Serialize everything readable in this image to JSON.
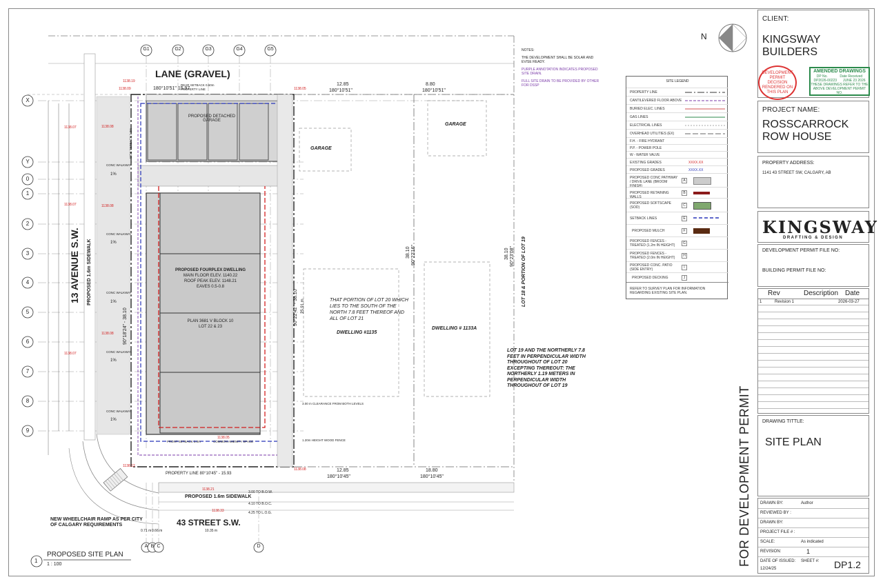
{
  "title_block": {
    "client_label": "CLIENT:",
    "client_name": "KINGSWAY BUILDERS",
    "stamp_text": "DEVELOPMENT PERMIT DECISION RENDERED ON THIS PLAN",
    "amended_title": "AMENDED DRAWINGS",
    "amended_dp_no_label": "DP No.",
    "amended_date_label": "Date Received",
    "amended_dp_no": "DP2026-00223",
    "amended_date": "JUNE 23 2026",
    "amended_note": "THESE DRAWINGS REFER TO THE ABOVE DEVELOPMENT PERMIT NO.",
    "project_name_label": "PROJECT NAME:",
    "project_name": "ROSSCARROCK ROW HOUSE",
    "property_address_label": "PROPERTY ADDRESS:",
    "property_address": "1141 43 STREET SW, CALGARY, AB",
    "logo_main": "KINGSWAY",
    "logo_sub": "DRAFTING & DESIGN",
    "dp_file_label": "DEVELOPMENT PERMIT FILE NO:",
    "bp_file_label": "BUILDING PERMIT  FILE NO:",
    "rev_headers": [
      "Rev",
      "Description",
      "Date"
    ],
    "revisions": [
      {
        "rev": "1",
        "description": "Revision 1",
        "date": "2026-03-27"
      }
    ],
    "drawing_title_label": "DRAWING TITTLE:",
    "drawing_title": "SITE PLAN",
    "drawn_by_label": "DRAWN BY:",
    "drawn_by": "Author",
    "reviewed_by_label": "REVIEWED BY :",
    "drawn_by2_label": "DRAWN BY:",
    "project_file_label": "PROJECT FILE # :",
    "scale_label": "SCALE:",
    "scale": "As indicated",
    "revision_label": "REVISION:",
    "revision": "1",
    "date_issued_label": "DATE OF ISSUED:",
    "date_issued": "12/24/25",
    "sheet_label": "SHEET #:",
    "sheet": "DP1.2"
  },
  "vertical_banner": "FOR DEVELOPMENT PERMIT",
  "legend": {
    "title": "SITE LEGEND",
    "rows": [
      {
        "label": "PROPERTY LINE",
        "key": ""
      },
      {
        "label": "CANTILEVERED FLOOR ABOVE",
        "key": ""
      },
      {
        "label": "BURIED ELEC. LINES",
        "key": ""
      },
      {
        "label": "GAS LINES",
        "key": ""
      },
      {
        "label": "ELECTRICAL LINES",
        "key": ""
      },
      {
        "label": "OVERHEAD UTILITIES (EX)",
        "key": ""
      },
      {
        "label": "F.H. - FIRE HYDRANT",
        "key": ""
      },
      {
        "label": "P.P. - POWER POLE",
        "key": ""
      },
      {
        "label": "W - WATER VALVE",
        "key": ""
      },
      {
        "label": "EXISTING GRADES",
        "key": "XXXX.XX"
      },
      {
        "label": "PROPOSED GRADES",
        "key": "XXXX.XX"
      },
      {
        "label": "PROPOSED CONC PATHWAY / DRIVE LANE (BROOM FINISH)",
        "key": "A"
      },
      {
        "label": "PROPOSED RETAINING WALLS",
        "key": "B"
      },
      {
        "label": "PROPOSED SOFTSCAPE (SOD)",
        "key": "C"
      },
      {
        "label": "SETBACK LINES",
        "key": "E"
      },
      {
        "label": "PROPOSED MULCH",
        "key": "F"
      },
      {
        "label": "PROPOSED FENCES - TREATED (1.2m IN HEIGHT)",
        "key": "G"
      },
      {
        "label": "PROPOSED FENCES - TREATED (2.0m IN HEIGHT)",
        "key": "H"
      },
      {
        "label": "PROPOSED CONC. PATIO (SIDE ENTRY)",
        "key": "I"
      },
      {
        "label": "PROPOSED DECKING",
        "key": "J"
      }
    ],
    "footer": "REFER TO SURVEY PLAN FOR INFORMATION REGARDING EXISTING SITE PLAN."
  },
  "notes": {
    "heading": "NOTES:",
    "items": [
      "THE DEVELOPMENT SHALL BE SOLAR AND EV/SE READY.",
      "PURPLE ANNOTATION INDICATES PROPOSED SITE DRAIN.",
      "FULL SITE DRAIN TO BE PROVIDED BY OTHER FOR DSSP"
    ]
  },
  "plan": {
    "lane": "LANE (GRAVEL)",
    "avenue": "13 AVENUE S.W.",
    "street": "43 STREET S.W.",
    "sidewalk_left": "PROPOSED 1.6m SIDEWALK",
    "sidewalk_bottom": "PROPOSED 1.6m SIDEWALK",
    "garage_proposed": "PROPOSED DETACHED GARAGE",
    "garage_neighbor": "GARAGE",
    "garage_neighbor2": "GARAGE",
    "dwelling_title": "PROPOSED FOURPLEX DWELLING",
    "main_floor": "MAIN FLOOR ELEV. 1140.22",
    "roof_peak": "ROOF PEAK ELEV. 1148.21",
    "eaves": "EAVES 0.5-0.8",
    "plan_no": "PLAN 3681 V    BLOCK 10",
    "lots": "LOT 22 & 23",
    "lot20_text": "THAT PORTION OF LOT 20 WHICH LIES TO THE SOUTH OF THE NORTH 7.8 FEET THEREOF AND ALL OF LOT 21",
    "dwelling_1135": "DWELLING #1135",
    "dwelling_1133": "DWELLING # 1133A",
    "lot19_text": "LOT 19 AND THE NORTHERLY 7.8 FEET IN PERPENDICULAR WIDTH THROUGHOUT OF LOT 20 EXCEPTING THEREOUT: THE NORTHERLY 1.19 METERS IN PERPENDICULAR WIDTH THROUGHOUT OF LOT 19",
    "lot18_text": "LOT 18 & PORTION OF LOT 19",
    "wheelchair": "NEW WHEELCHAIR RAMP AS PER CITY OF CALGARY REQUIREMENTS",
    "plan_caption": "PROPOSED SITE PLAN",
    "plan_scale": "1 : 100",
    "plan_num": "1",
    "north": "N",
    "grid_top": [
      "G1",
      "G2",
      "G3",
      "G4",
      "G5"
    ],
    "grid_left": [
      "X",
      "Y",
      "0",
      "1",
      "2",
      "3",
      "4",
      "5",
      "6",
      "7",
      "8",
      "9"
    ],
    "grid_bottom": [
      "A",
      "B",
      "C",
      "D"
    ],
    "dim_top_1": "180°10'51\"  15.97",
    "dim_top_label": "PROPERTY LINE",
    "dim_top_2": "12.85",
    "dim_top_2b": "180°10'51\"",
    "dim_top_3": "8.80",
    "dim_top_3b": "180°10'51\"",
    "dim_bottom_1": "PROPERTY LINE 80°10'45\" - 15.93",
    "dim_bottom_2": "12.85",
    "dim_bottom_2b": "180°10'45\"",
    "dim_bottom_3": "18.80",
    "dim_bottom_3b": "180°10'45\"",
    "dim_right_1": "38.10",
    "dim_right_1b": "90°22'16\"",
    "dim_right_2": "38.10",
    "dim_right_2b": "90°23'08\"",
    "dim_mid": "90°22'42\" - 38.10",
    "dim_mid2": "25.91 m",
    "dim_left": "90°18'24\" - 38.10",
    "bottom_dims": [
      "0.71 m",
      "0.66 m",
      "10.35 m"
    ],
    "sidewalk_marks": [
      "3.00 TO B.O.W.",
      "4.10 TO B.O.C.",
      "4.25 TO L.O.G."
    ],
    "concwalk": "CONC WALKWAY",
    "one_pct": "1%",
    "front_setback": "FRONT SETBACK 3.0m",
    "amenity": "COMMON AMENITY SPACE",
    "clearance": "3.00 m CLEARANCE FROM  BOTH LEVELS",
    "wood_fence": "1.20m HEIGHT WOOD FENCE",
    "rear_setback": "REAR SETBACK 0.60m",
    "side_setback": "SIDE SETBACK 1.2m",
    "grade_tags": [
      "1138.19",
      "1138.09",
      "1138.07",
      "1138.08",
      "1138.07",
      "1138.08",
      "1138.08",
      "1138.07",
      "1138.12",
      "1138.08",
      "1138.05",
      "1138.05",
      "1138.21",
      "1138.33"
    ]
  }
}
